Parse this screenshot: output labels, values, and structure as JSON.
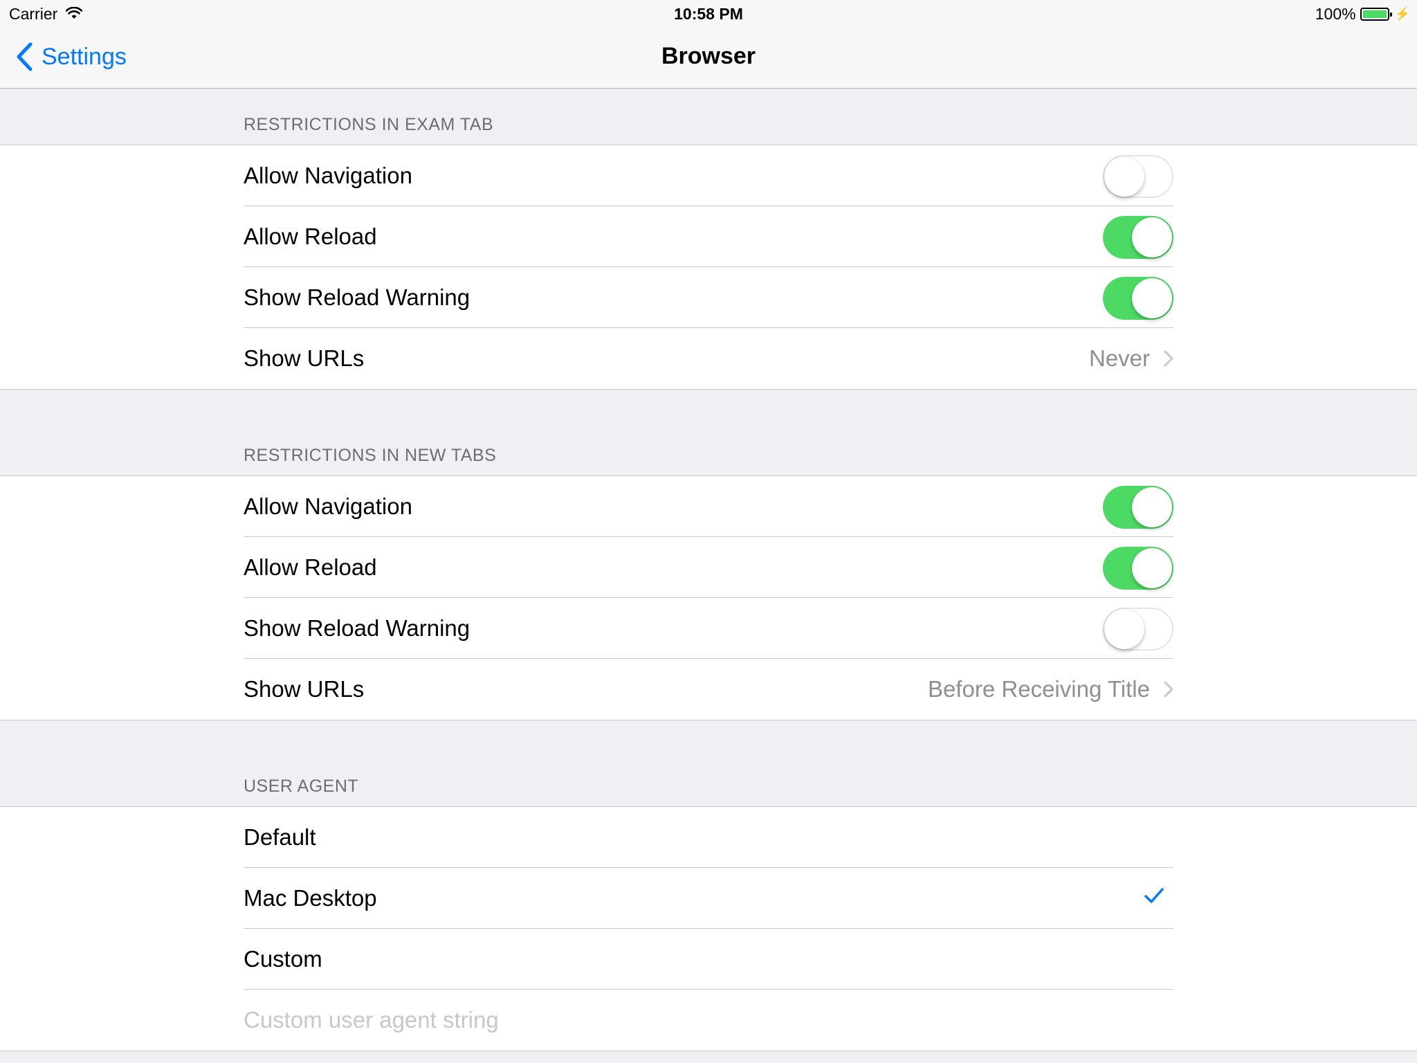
{
  "status": {
    "carrier": "Carrier",
    "time": "10:58 PM",
    "battery": "100%",
    "battery_level": 1.0
  },
  "nav": {
    "back_label": "Settings",
    "title": "Browser"
  },
  "sections": {
    "exam_tab": {
      "header": "RESTRICTIONS IN EXAM TAB",
      "allow_navigation": {
        "label": "Allow Navigation",
        "on": false
      },
      "allow_reload": {
        "label": "Allow Reload",
        "on": true
      },
      "show_reload_warning": {
        "label": "Show Reload Warning",
        "on": true
      },
      "show_urls": {
        "label": "Show URLs",
        "value": "Never"
      }
    },
    "new_tabs": {
      "header": "RESTRICTIONS IN NEW TABS",
      "allow_navigation": {
        "label": "Allow Navigation",
        "on": true
      },
      "allow_reload": {
        "label": "Allow Reload",
        "on": true
      },
      "show_reload_warning": {
        "label": "Show Reload Warning",
        "on": false
      },
      "show_urls": {
        "label": "Show URLs",
        "value": "Before Receiving Title"
      }
    },
    "user_agent": {
      "header": "USER AGENT",
      "options": [
        "Default",
        "Mac Desktop",
        "Custom"
      ],
      "selected": "Mac Desktop",
      "custom_placeholder": "Custom user agent string"
    }
  },
  "colors": {
    "accent": "#007aff",
    "toggle_on": "#4cd964",
    "background": "#efeff4"
  }
}
